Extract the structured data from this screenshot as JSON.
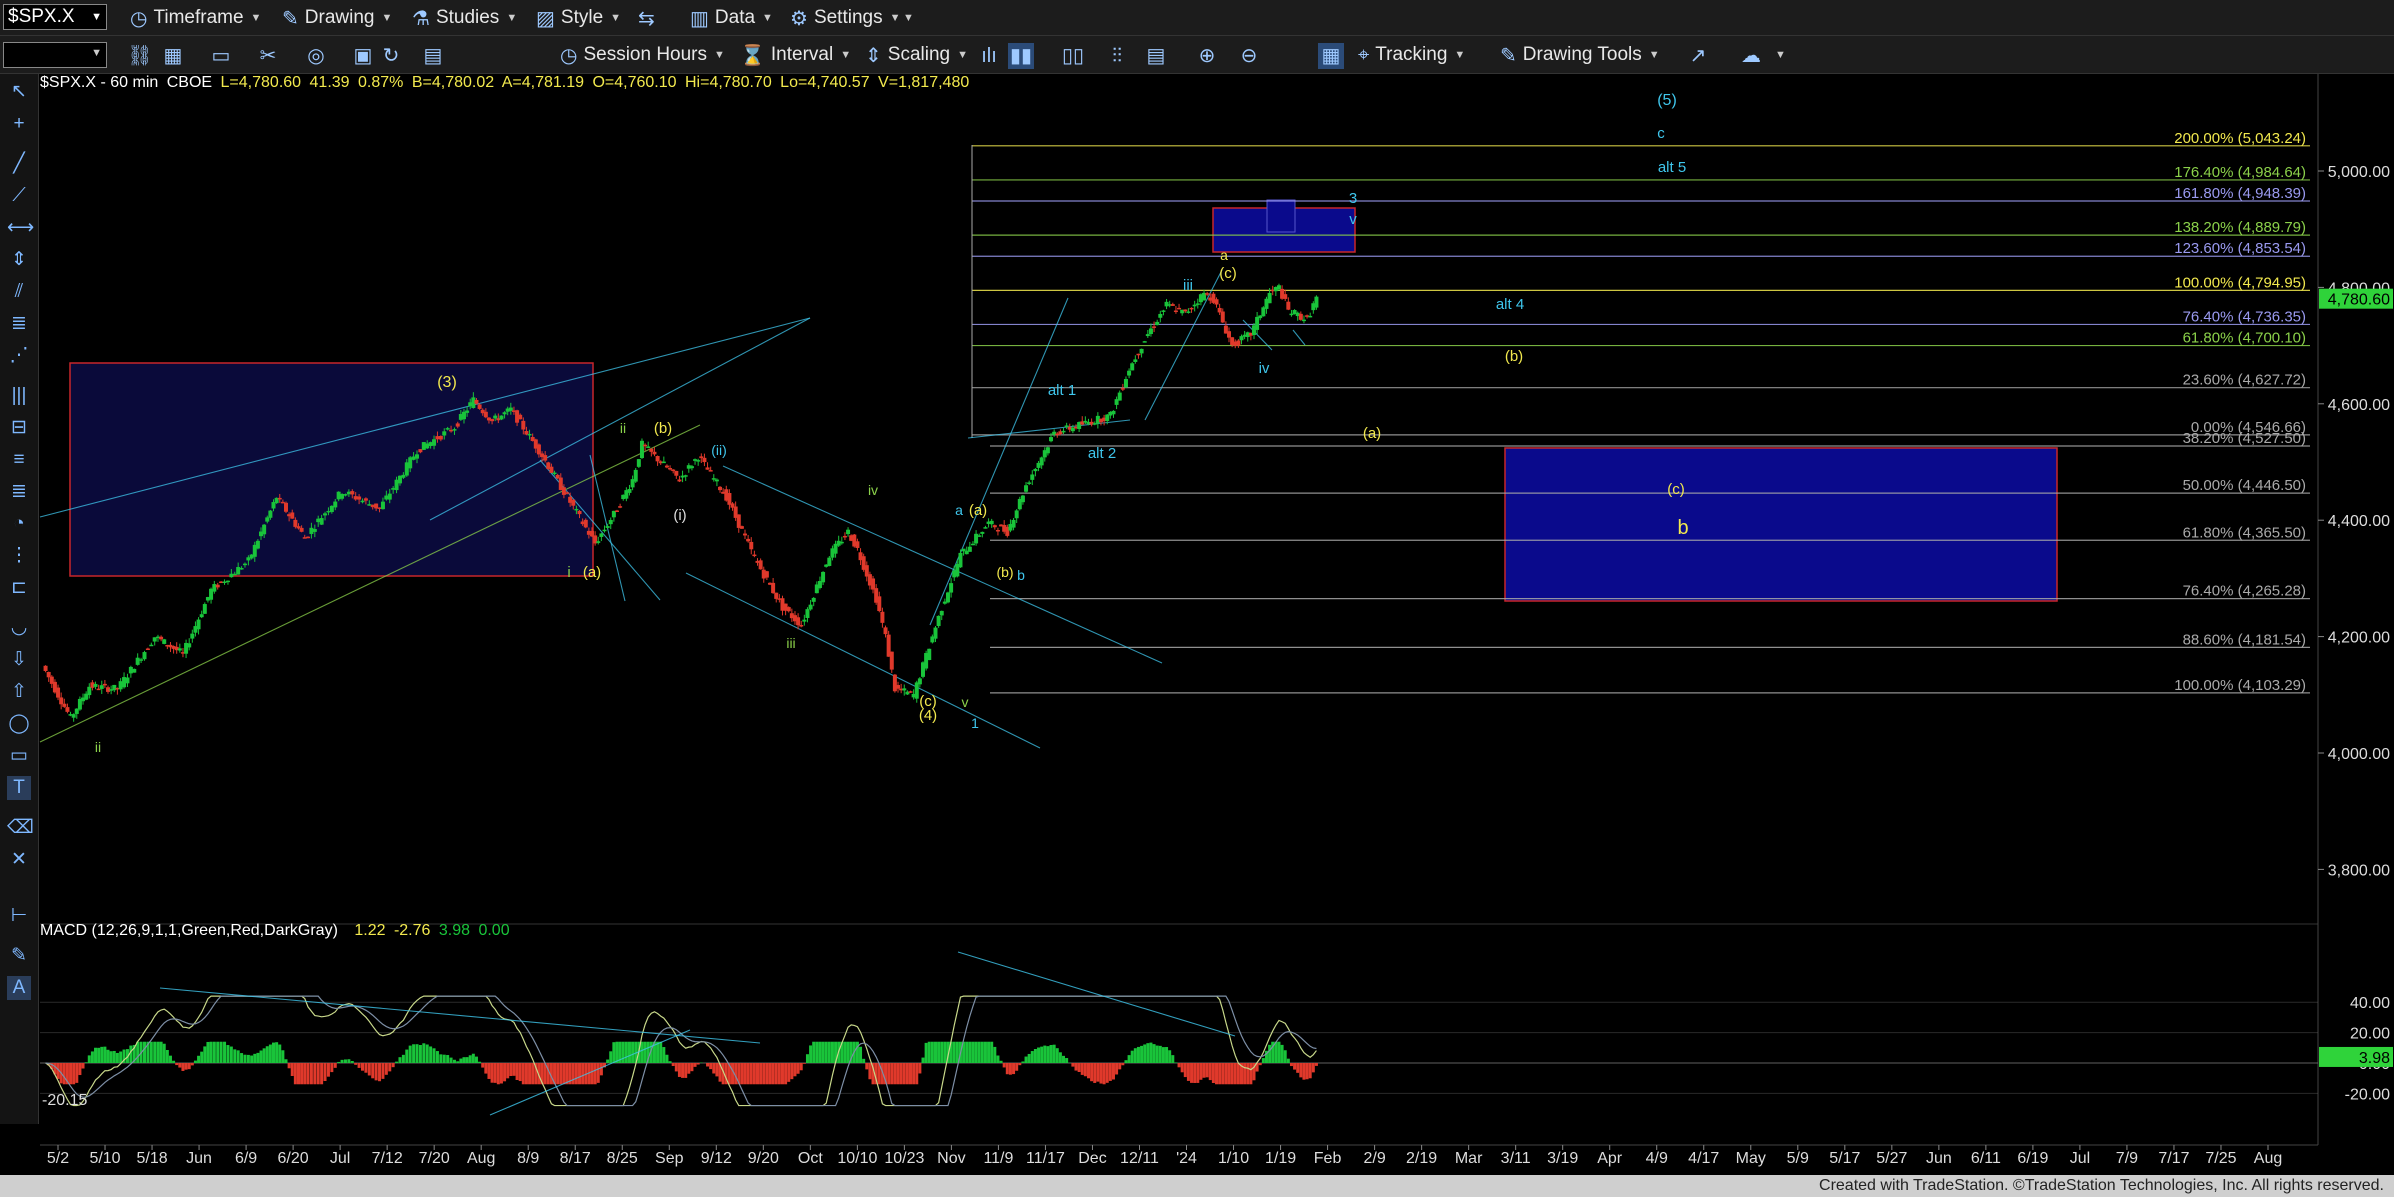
{
  "toolbar1": {
    "symbol": "$SPX.X",
    "timeframe": "Timeframe",
    "drawing": "Drawing",
    "studies": "Studies",
    "style": "Style",
    "data": "Data",
    "settings": "Settings"
  },
  "toolbar2": {
    "session_hours": "Session Hours",
    "interval": "Interval",
    "scaling": "Scaling",
    "tracking": "Tracking",
    "drawing_tools": "Drawing Tools"
  },
  "header": {
    "symbol": "$SPX.X - 60 min",
    "exchange": "CBOE",
    "last": "L=4,780.60",
    "change": "41.39",
    "change_pct": "0.87%",
    "bid": "B=4,780.02",
    "ask": "A=4,781.19",
    "open": "O=4,760.10",
    "high": "Hi=4,780.70",
    "low": "Lo=4,740.57",
    "volume": "V=1,817,480"
  },
  "macd_header": {
    "label": "MACD (12,26,9,1,1,Green,Red,DarkGray)",
    "v1": "1.22",
    "v2": "-2.76",
    "v3": "3.98",
    "v4": "0.00",
    "left_label": "-20.15"
  },
  "colors": {
    "up": "#19c43a",
    "down": "#e0392b",
    "wave_yellow": "#f2e94e",
    "wave_green": "#8bd14a",
    "wave_cyan": "#3fc6ec",
    "fib_blue": "#6a6ad8",
    "box_navy": "#0a0a8c",
    "box_border": "#c8262a",
    "last_price": "#2fd33a"
  },
  "chart_data": {
    "type": "candlestick",
    "instrument": "$SPX.X",
    "interval": "60 min",
    "price_axis": {
      "range": [
        3740,
        5100
      ],
      "ticks": [
        "5,000.00",
        "4,800.00",
        "4,600.00",
        "4,400.00",
        "4,200.00",
        "4,000.00",
        "3,800.00"
      ],
      "tick_values": [
        5000,
        4800,
        4600,
        4400,
        4200,
        4000,
        3800
      ],
      "last_price_label": "4,780.60",
      "last_price": 4780.6
    },
    "date_axis": {
      "ticks": [
        "5/2",
        "5/10",
        "5/18",
        "Jun",
        "6/9",
        "6/20",
        "Jul",
        "7/12",
        "7/20",
        "Aug",
        "8/9",
        "8/17",
        "8/25",
        "Sep",
        "9/12",
        "9/20",
        "Oct",
        "10/10",
        "10/23",
        "Nov",
        "11/9",
        "11/17",
        "Dec",
        "12/11",
        "'24",
        "1/10",
        "1/19",
        "Feb",
        "2/9",
        "2/19",
        "Mar",
        "3/11",
        "3/19",
        "Apr",
        "4/9",
        "4/17",
        "May",
        "5/9",
        "5/17",
        "5/27",
        "Jun",
        "6/11",
        "6/19",
        "Jul",
        "7/9",
        "7/17",
        "7/25",
        "Aug"
      ]
    },
    "price_path": [
      [
        0,
        4150
      ],
      [
        3,
        4060
      ],
      [
        5,
        4115
      ],
      [
        8,
        4110
      ],
      [
        12,
        4200
      ],
      [
        15,
        4170
      ],
      [
        18,
        4280
      ],
      [
        22,
        4330
      ],
      [
        25,
        4440
      ],
      [
        28,
        4370
      ],
      [
        32,
        4450
      ],
      [
        36,
        4420
      ],
      [
        40,
        4520
      ],
      [
        44,
        4560
      ],
      [
        46,
        4607
      ],
      [
        48,
        4570
      ],
      [
        50,
        4590
      ],
      [
        53,
        4520
      ],
      [
        56,
        4440
      ],
      [
        59,
        4360
      ],
      [
        61,
        4410
      ],
      [
        63,
        4470
      ],
      [
        64,
        4530
      ],
      [
        66,
        4500
      ],
      [
        68,
        4470
      ],
      [
        70,
        4510
      ],
      [
        73,
        4440
      ],
      [
        76,
        4335
      ],
      [
        79,
        4250
      ],
      [
        81,
        4220
      ],
      [
        84,
        4340
      ],
      [
        86,
        4380
      ],
      [
        87,
        4350
      ],
      [
        89,
        4265
      ],
      [
        90,
        4200
      ],
      [
        91,
        4110
      ],
      [
        93,
        4100
      ],
      [
        96,
        4250
      ],
      [
        98,
        4340
      ],
      [
        101,
        4395
      ],
      [
        103,
        4380
      ],
      [
        105,
        4460
      ],
      [
        108,
        4550
      ],
      [
        110,
        4560
      ],
      [
        112,
        4570
      ],
      [
        114,
        4580
      ],
      [
        116,
        4660
      ],
      [
        118,
        4720
      ],
      [
        120,
        4770
      ],
      [
        122,
        4755
      ],
      [
        124,
        4790
      ],
      [
        125,
        4780
      ],
      [
        127,
        4700
      ],
      [
        129,
        4720
      ],
      [
        131,
        4790
      ],
      [
        132,
        4800
      ],
      [
        133,
        4760
      ],
      [
        135,
        4745
      ],
      [
        136,
        4782
      ]
    ],
    "fib_levels": [
      {
        "label": "200.00% (5,043.24)",
        "value": 5043.24,
        "color": "#f2e94e"
      },
      {
        "label": "176.40% (4,984.64)",
        "value": 4984.64,
        "color": "#8bd14a"
      },
      {
        "label": "161.80% (4,948.39)",
        "value": 4948.39,
        "color": "#9a9af0"
      },
      {
        "label": "138.20% (4,889.79)",
        "value": 4889.79,
        "color": "#8bd14a"
      },
      {
        "label": "123.60% (4,853.54)",
        "value": 4853.54,
        "color": "#9a9af0"
      },
      {
        "label": "100.00% (4,794.95)",
        "value": 4794.95,
        "color": "#f2e94e"
      },
      {
        "label": "76.40% (4,736.35)",
        "value": 4736.35,
        "color": "#9a9af0"
      },
      {
        "label": "61.80% (4,700.10)",
        "value": 4700.1,
        "color": "#8bd14a"
      },
      {
        "label": "23.60% (4,627.72)",
        "value": 4627.72,
        "color": "#aaaaaa"
      },
      {
        "label": "0.00% (4,546.66)",
        "value": 4546.66,
        "color": "#aaaaaa"
      },
      {
        "label": "38.20% (4,527.50)",
        "value": 4527.5,
        "color": "#aaaaaa"
      },
      {
        "label": "50.00% (4,446.50)",
        "value": 4446.5,
        "color": "#aaaaaa"
      },
      {
        "label": "61.80% (4,365.50)",
        "value": 4365.5,
        "color": "#aaaaaa"
      },
      {
        "label": "76.40% (4,265.28)",
        "value": 4265.28,
        "color": "#aaaaaa"
      },
      {
        "label": "88.60% (4,181.54)",
        "value": 4181.54,
        "color": "#aaaaaa"
      },
      {
        "label": "100.00% (4,103.29)",
        "value": 4103.29,
        "color": "#aaaaaa"
      }
    ],
    "wave_labels": [
      {
        "text": "(5)",
        "color": "#3fc6ec"
      },
      {
        "text": "c",
        "color": "#3fc6ec"
      },
      {
        "text": "alt 5",
        "color": "#3fc6ec"
      },
      {
        "text": "3",
        "color": "#3fc6ec"
      },
      {
        "text": "v",
        "color": "#3fc6ec"
      },
      {
        "text": "a",
        "color": "#f2e94e"
      },
      {
        "text": "(c)",
        "color": "#f2e94e"
      },
      {
        "text": "iii",
        "color": "#3fc6ec"
      },
      {
        "text": "alt 4",
        "color": "#3fc6ec"
      },
      {
        "text": "iv",
        "color": "#3fc6ec"
      },
      {
        "text": "(b)",
        "color": "#f2e94e"
      },
      {
        "text": "alt 1",
        "color": "#3fc6ec"
      },
      {
        "text": "alt 2",
        "color": "#3fc6ec"
      },
      {
        "text": "(a)",
        "color": "#f2e94e"
      },
      {
        "text": "(c)",
        "color": "#f2e94e"
      },
      {
        "text": "b",
        "color": "#f2e94e"
      },
      {
        "text": "(3)",
        "color": "#f2e94e"
      },
      {
        "text": "ii",
        "color": "#8bd14a"
      },
      {
        "text": "(b)",
        "color": "#f2e94e"
      },
      {
        "text": "(ii)",
        "color": "#3fc6ec"
      },
      {
        "text": "(i)",
        "color": "#dddddd"
      },
      {
        "text": "i",
        "color": "#8bd14a"
      },
      {
        "text": "(a)",
        "color": "#f2e94e"
      },
      {
        "text": "iv",
        "color": "#8bd14a"
      },
      {
        "text": "iii",
        "color": "#8bd14a"
      },
      {
        "text": "a",
        "color": "#3fc6ec"
      },
      {
        "text": "(a)",
        "color": "#f2e94e"
      },
      {
        "text": "(b)",
        "color": "#f2e94e"
      },
      {
        "text": "b",
        "color": "#3fc6ec"
      },
      {
        "text": "(c)",
        "color": "#f2e94e"
      },
      {
        "text": "(4)",
        "color": "#f2e94e"
      },
      {
        "text": "v",
        "color": "#8bd14a"
      },
      {
        "text": "1",
        "color": "#3fc6ec"
      },
      {
        "text": "ii",
        "color": "#8bd14a"
      }
    ],
    "macd": {
      "axis_ticks": [
        "40.00",
        "20.00",
        "0.00",
        "-20.00"
      ],
      "tick_values": [
        40,
        20,
        0,
        -20
      ],
      "last_label": "3.98"
    }
  },
  "statusbar": {
    "text": "Created with TradeStation. ©TradeStation Technologies, Inc. All rights reserved."
  }
}
